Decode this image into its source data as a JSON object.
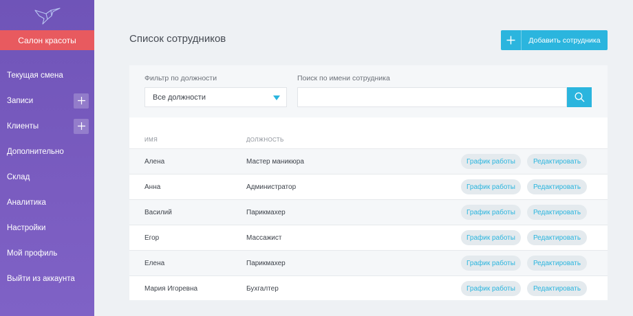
{
  "sidebar": {
    "salon_label": "Салон красоты",
    "items": [
      {
        "label": "Текущая смена",
        "plus": false
      },
      {
        "label": "Записи",
        "plus": true
      },
      {
        "label": "Клиенты",
        "plus": true
      },
      {
        "label": "Дополнительно",
        "plus": false
      },
      {
        "label": "Склад",
        "plus": false
      },
      {
        "label": "Аналитика",
        "plus": false
      },
      {
        "label": "Настройки",
        "plus": false
      },
      {
        "label": "Мой профиль",
        "plus": false
      },
      {
        "label": "Выйти из аккаунта",
        "plus": false
      }
    ]
  },
  "header": {
    "title": "Список сотрудников",
    "add_label": "Добавить сотрудника"
  },
  "filters": {
    "position_label": "Фильтр по должности",
    "position_value": "Все должности",
    "search_label": "Поиск по имени сотрудника",
    "search_value": "",
    "search_placeholder": ""
  },
  "table": {
    "columns": [
      "имя",
      "должность"
    ],
    "schedule_label": "График работы",
    "edit_label": "Редактировать",
    "rows": [
      {
        "name": "Алена",
        "position": "Мастер маникюра"
      },
      {
        "name": "Анна",
        "position": "Администратор"
      },
      {
        "name": "Василий",
        "position": "Парикмахер"
      },
      {
        "name": "Егор",
        "position": "Массажист"
      },
      {
        "name": "Елена",
        "position": "Парикмахер"
      },
      {
        "name": "Мария Игоревна",
        "position": "Бухгалтер"
      }
    ]
  },
  "colors": {
    "sidebar": "#7a5cc0",
    "salon": "#e85a5f",
    "accent": "#2bb5de"
  }
}
